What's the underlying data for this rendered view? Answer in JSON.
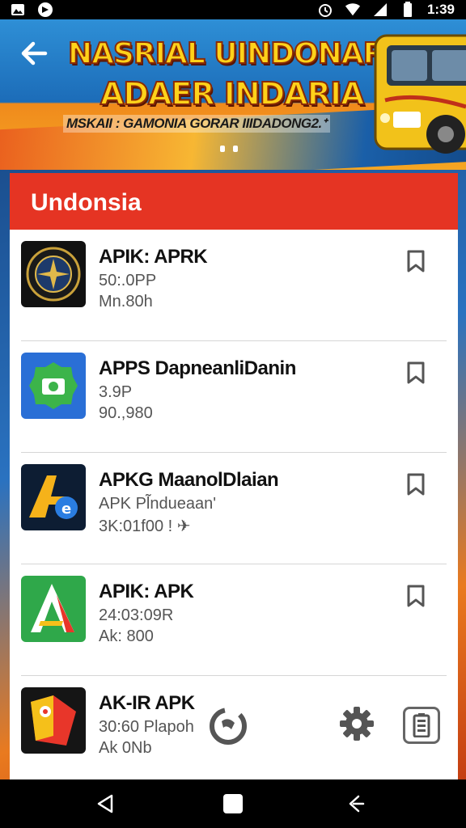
{
  "status_bar": {
    "time": "1:39",
    "left_icons": [
      "image-icon",
      "circle-app-icon"
    ],
    "right_icons": [
      "alarm-icon",
      "wifi-icon",
      "signal-icon",
      "battery-icon"
    ]
  },
  "banner": {
    "line1": "NASRIAL UINDONAR",
    "line2": "ADAER INDARIA",
    "tagline": "MSKAII : GAMONIA GORAR IIIDADONG2.ᐩ",
    "page_indicator": {
      "count": 2,
      "active": 0
    }
  },
  "card": {
    "title": "Undonsia"
  },
  "apps": [
    {
      "name": "APIK: APRK",
      "sub1": "50:.0PP",
      "sub2": "Mn.80h",
      "icon": "emblem-icon"
    },
    {
      "name": "APPS DapneanliDanin",
      "sub1": "3.9P",
      "sub2": "90.,980",
      "icon": "camera-badge-icon"
    },
    {
      "name": "APKG MaanolDlaian",
      "sub1": "APK Pl̃ndueaan' ",
      "sub2": "3K:01f00 ! ✈",
      "icon": "a-letter-icon"
    },
    {
      "name": "APIK: APK",
      "sub1": "24:03:09R",
      "sub2": "Ak: 800",
      "icon": "a-triangle-icon"
    },
    {
      "name": "AK-IR APK",
      "sub1": "30:60 Plapoh",
      "sub2": "Ak 0Nb",
      "icon": "map-pin-icon"
    }
  ],
  "colors": {
    "header_red": "#e53423",
    "banner_yellow": "#ffd21a"
  },
  "nav": {
    "buttons": [
      "back-icon",
      "home-icon",
      "recents-icon"
    ]
  }
}
